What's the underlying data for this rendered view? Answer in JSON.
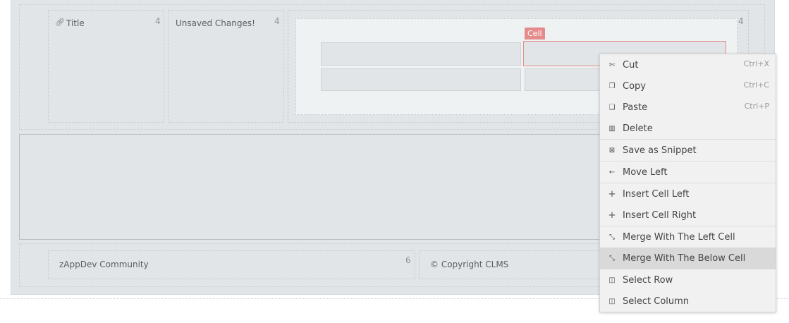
{
  "header_row": {
    "title_column": {
      "icon": "link-icon",
      "label": "Title",
      "size": "4"
    },
    "unsaved_column": {
      "label": "Unsaved Changes!",
      "size": "4"
    },
    "grid_column": {
      "size": "4",
      "cell_tag": "Cell"
    }
  },
  "footer_row": {
    "community_column": {
      "label": "zAppDev Community",
      "size": "6"
    },
    "copyright_column": {
      "label": "© Copyright CLMS"
    }
  },
  "context_menu": {
    "cut": {
      "icon": "scissors-icon",
      "label": "Cut",
      "shortcut": "Ctrl+X"
    },
    "copy": {
      "icon": "copy-icon",
      "label": "Copy",
      "shortcut": "Ctrl+C"
    },
    "paste": {
      "icon": "paste-icon",
      "label": "Paste",
      "shortcut": "Ctrl+P"
    },
    "delete": {
      "icon": "trash-icon",
      "label": "Delete"
    },
    "save_snippet": {
      "icon": "snippet-icon",
      "label": "Save as Snippet"
    },
    "move_left": {
      "icon": "arrow-left-icon",
      "label": "Move Left"
    },
    "insert_left": {
      "icon": "plus-icon",
      "label": "Insert Cell Left"
    },
    "insert_right": {
      "icon": "plus-icon",
      "label": "Insert Cell Right"
    },
    "merge_left": {
      "icon": "merge-icon",
      "label": "Merge With The Left Cell"
    },
    "merge_below": {
      "icon": "merge-icon",
      "label": "Merge With The Below Cell",
      "highlighted": true
    },
    "select_row": {
      "icon": "columns-icon",
      "label": "Select Row"
    },
    "select_column": {
      "icon": "columns-icon",
      "label": "Select Column"
    }
  },
  "colors": {
    "canvas": "#e2e5e7",
    "selection": "#e58b8b",
    "menu_bg": "#f1f1f1",
    "menu_highlight": "#d9d9d9"
  }
}
